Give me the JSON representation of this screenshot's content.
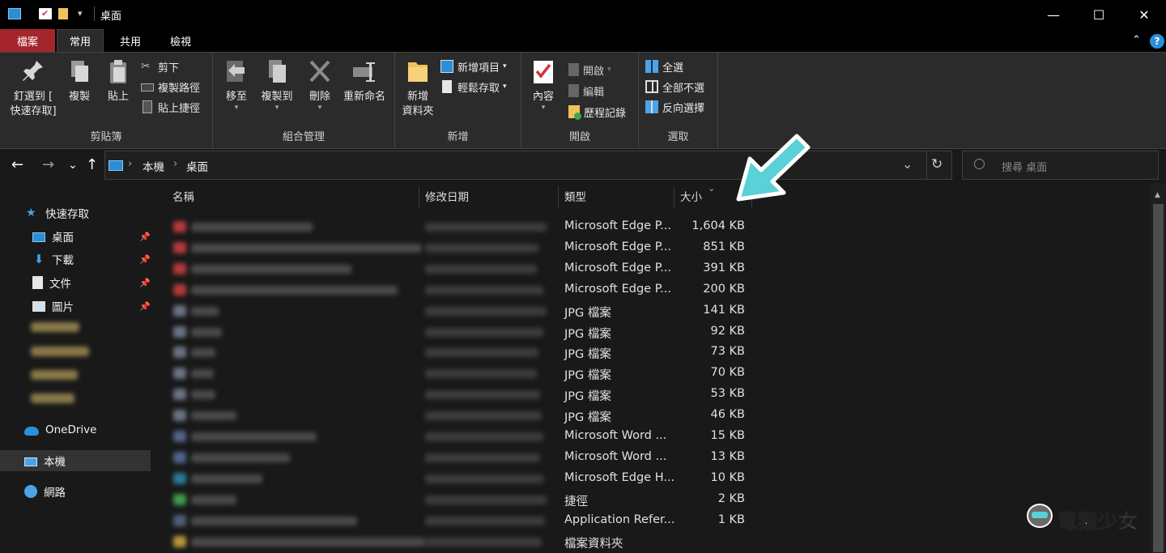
{
  "window": {
    "title": "桌面",
    "minimize": "—",
    "maximize": "☐",
    "close": "✕",
    "qa_dropdown": "▾"
  },
  "ribbon_tabs": [
    "檔案",
    "常用",
    "共用",
    "檢視"
  ],
  "ribbon": {
    "clipboard": {
      "label": "剪貼簿",
      "pin_line1": "釘選到 [",
      "pin_line2": "快速存取]",
      "copy": "複製",
      "paste": "貼上",
      "cut": "剪下",
      "copy_path": "複製路徑",
      "paste_shortcut": "貼上捷徑"
    },
    "organize": {
      "label": "組合管理",
      "move_to": "移至",
      "copy_to": "複製到",
      "delete": "刪除",
      "rename": "重新命名"
    },
    "new": {
      "label": "新增",
      "new_folder_line1": "新增",
      "new_folder_line2": "資料夾",
      "new_item": "新增項目",
      "easy_access": "輕鬆存取"
    },
    "open": {
      "label": "開啟",
      "properties": "內容",
      "open": "開啟",
      "edit": "編輯",
      "history": "歷程記錄"
    },
    "select": {
      "label": "選取",
      "select_all": "全選",
      "select_none": "全部不選",
      "invert": "反向選擇"
    }
  },
  "nav": {
    "back": "←",
    "forward": "→",
    "recent": "⌄",
    "up": "↑",
    "breadcrumb": [
      "本機",
      "桌面"
    ],
    "sep": "›",
    "refresh": "↻",
    "history_dropdown": "⌄",
    "search_placeholder": "搜尋 桌面"
  },
  "sidebar": {
    "quick_access": "快速存取",
    "pinned": [
      {
        "label": "桌面",
        "icon": "desktop-icon"
      },
      {
        "label": "下載",
        "icon": "download-icon"
      },
      {
        "label": "文件",
        "icon": "documents-icon"
      },
      {
        "label": "圖片",
        "icon": "pictures-icon"
      }
    ],
    "onedrive": "OneDrive",
    "this_pc": "本機",
    "network": "網路"
  },
  "columns": {
    "name": "名稱",
    "date": "修改日期",
    "type": "類型",
    "size": "大小"
  },
  "files": [
    {
      "type": "Microsoft Edge P...",
      "size": "1,604 KB",
      "color": "#b43a3a"
    },
    {
      "type": "Microsoft Edge P...",
      "size": "851 KB",
      "color": "#b43a3a"
    },
    {
      "type": "Microsoft Edge P...",
      "size": "391 KB",
      "color": "#b43a3a"
    },
    {
      "type": "Microsoft Edge P...",
      "size": "200 KB",
      "color": "#b43a3a"
    },
    {
      "type": "JPG 檔案",
      "size": "141 KB",
      "color": "#6a7385"
    },
    {
      "type": "JPG 檔案",
      "size": "92 KB",
      "color": "#6a7385"
    },
    {
      "type": "JPG 檔案",
      "size": "73 KB",
      "color": "#6a7385"
    },
    {
      "type": "JPG 檔案",
      "size": "70 KB",
      "color": "#6a7385"
    },
    {
      "type": "JPG 檔案",
      "size": "53 KB",
      "color": "#6a7385"
    },
    {
      "type": "JPG 檔案",
      "size": "46 KB",
      "color": "#6a7385"
    },
    {
      "type": "Microsoft Word ...",
      "size": "15 KB",
      "color": "#51648a"
    },
    {
      "type": "Microsoft Word ...",
      "size": "13 KB",
      "color": "#51648a"
    },
    {
      "type": "Microsoft Edge H...",
      "size": "10 KB",
      "color": "#2d7a9a"
    },
    {
      "type": "捷徑",
      "size": "2 KB",
      "color": "#3f9a4a"
    },
    {
      "type": "Application Refer...",
      "size": "1 KB",
      "color": "#4f5f7a"
    },
    {
      "type": "檔案資料夾",
      "size": "",
      "color": "#b8953a"
    }
  ],
  "watermark": "電獺少女",
  "colors": {
    "accent_cyan": "#5ad0d8",
    "file_tab": "#a4262c",
    "folder": "#f2c25a"
  }
}
